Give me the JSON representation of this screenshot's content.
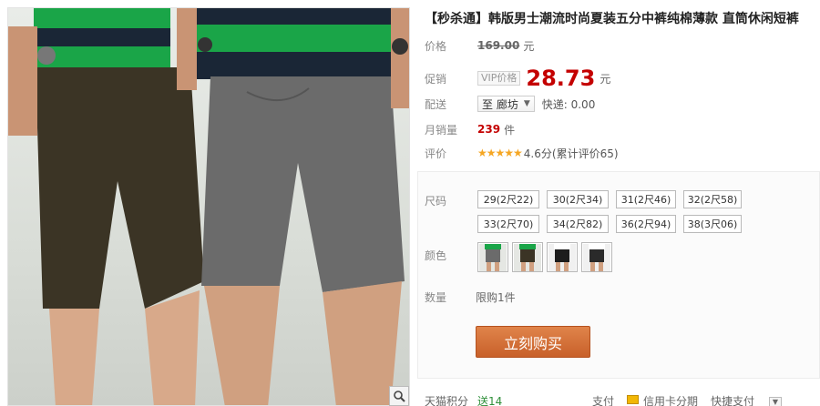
{
  "product": {
    "title": "【秒杀通】韩版男士潮流时尚夏装五分中裤纯棉薄款 直筒休闲短裤"
  },
  "price_row": {
    "label": "价格",
    "original_price": "169.00",
    "unit": "元"
  },
  "promo_row": {
    "label": "促销",
    "vip_tag": "VIP价格",
    "price": "28.73",
    "unit": "元"
  },
  "delivery_row": {
    "label": "配送",
    "location": "至 廊坊",
    "shipping": "快递: 0.00"
  },
  "sales_row": {
    "label": "月销量",
    "count": "239",
    "unit": "件"
  },
  "rating_row": {
    "label": "评价",
    "stars": "★★★★★",
    "rating_text": "4.6分(累计评价65)"
  },
  "size_options": {
    "label": "尺码",
    "items": [
      "29(2尺22)",
      "30(2尺34)",
      "31(2尺46)",
      "32(2尺58)",
      "33(2尺70)",
      "34(2尺82)",
      "36(2尺94)",
      "38(3尺06)"
    ]
  },
  "color_options": {
    "label": "颜色",
    "swatches": [
      "gray-green",
      "brown-green",
      "black-white",
      "black-white-2"
    ]
  },
  "quantity": {
    "label": "数量",
    "limit": "限购1件"
  },
  "buy_button": {
    "label": "立刻购买"
  },
  "bottom_bar": {
    "points_label": "天猫积分",
    "points_value": "送14",
    "pay_label": "支付",
    "credit_card": "信用卡分期",
    "quick_pay": "快捷支付"
  },
  "colors": {
    "price_red": "#c40000",
    "buy_orange": "#d46c34",
    "shirt_green": "#1aa548",
    "shirt_navy": "#1a2636"
  }
}
